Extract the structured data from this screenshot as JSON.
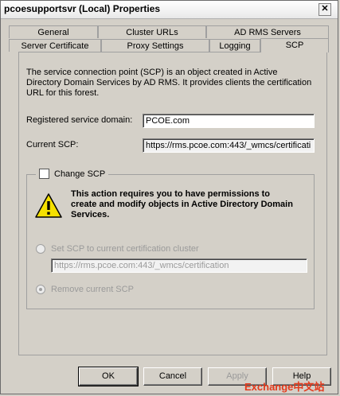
{
  "window": {
    "title": "pcoesupportsvr (Local) Properties",
    "close_glyph": "✕"
  },
  "tabs": {
    "row1": [
      "General",
      "Cluster URLs",
      "AD RMS Servers"
    ],
    "row2": [
      "Server Certificate",
      "Proxy Settings",
      "Logging",
      "SCP"
    ],
    "active": "SCP"
  },
  "scp": {
    "description": "The service connection point (SCP) is an object created in Active Directory Domain Services by AD RMS. It provides clients the certification URL for this forest.",
    "registered_label": "Registered service domain:",
    "registered_value": "PCOE.com",
    "current_label": "Current SCP:",
    "current_value": "https://rms.pcoe.com:443/_wmcs/certificati"
  },
  "change_scp": {
    "checkbox_label": "Change SCP",
    "checked": false,
    "warning": "This action requires you to have permissions to create and modify objects in Active Directory Domain Services.",
    "warning_icon": "warning-icon",
    "option_set_label": "Set SCP to current certification cluster",
    "option_set_value": "https://rms.pcoe.com:443/_wmcs/certification",
    "option_remove_label": "Remove current SCP",
    "selected_option": "remove"
  },
  "buttons": {
    "ok": "OK",
    "cancel": "Cancel",
    "apply": "Apply",
    "help": "Help"
  },
  "watermark": "Exchange中文站",
  "colors": {
    "dialog_bg": "#d4d0c8",
    "watermark": "#e43a1c",
    "warning_yellow": "#f5e000"
  }
}
